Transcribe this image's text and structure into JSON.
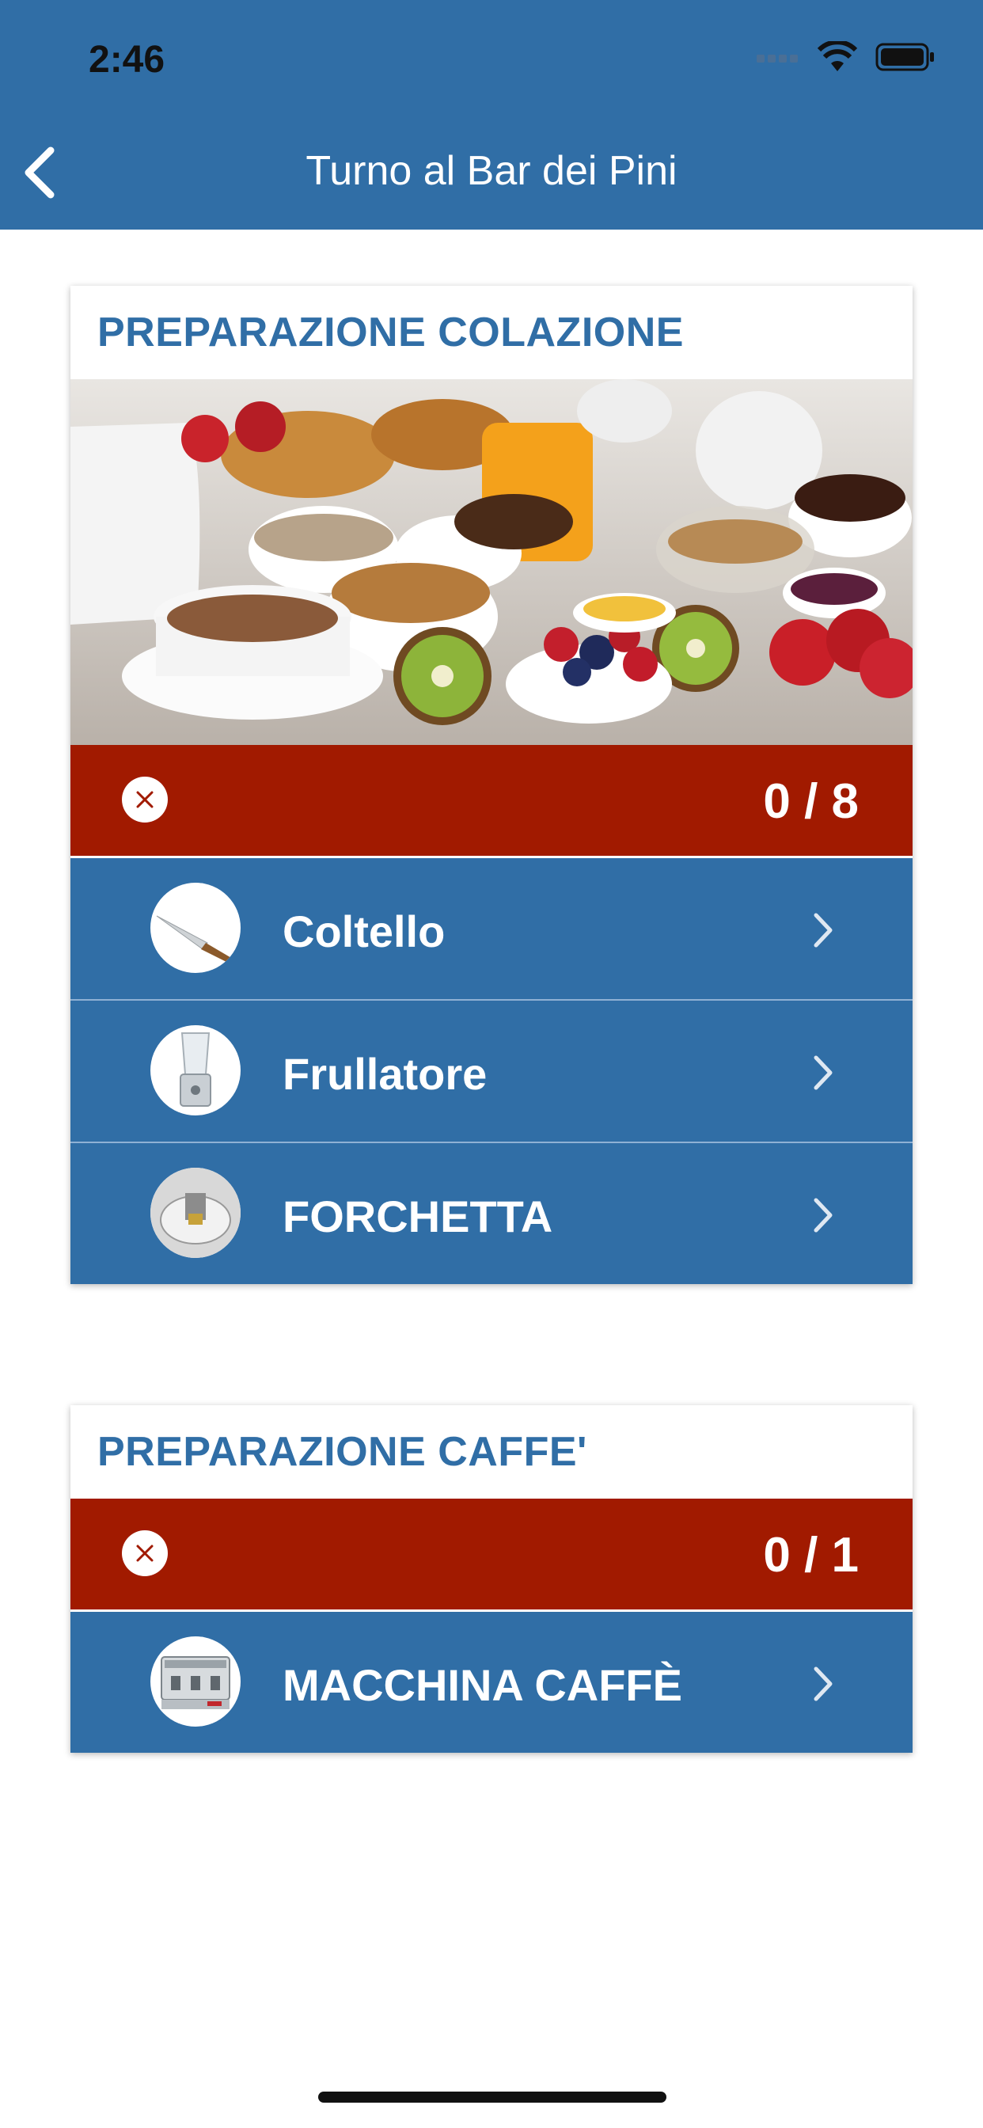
{
  "status_bar": {
    "time": "2:46"
  },
  "nav": {
    "title": "Turno al Bar dei Pini",
    "back_icon": "chevron-left-icon"
  },
  "sections": [
    {
      "title": "PREPARAZIONE COLAZIONE",
      "has_image": true,
      "image_icon": "breakfast-photo",
      "status_icon": "close-circle-icon",
      "progress": "0 / 8",
      "items": [
        {
          "label": "Coltello",
          "icon": "knife-thumbnail"
        },
        {
          "label": "Frullatore",
          "icon": "blender-thumbnail"
        },
        {
          "label": "FORCHETTA",
          "icon": "fork-thumbnail"
        }
      ]
    },
    {
      "title": "PREPARAZIONE CAFFE'",
      "has_image": false,
      "status_icon": "close-circle-icon",
      "progress": "0 / 1",
      "items": [
        {
          "label": "MACCHINA CAFFÈ",
          "icon": "coffee-machine-thumbnail"
        }
      ]
    }
  ],
  "colors": {
    "primary": "#306ea6",
    "error": "#a11a00",
    "background": "#ffffff"
  }
}
